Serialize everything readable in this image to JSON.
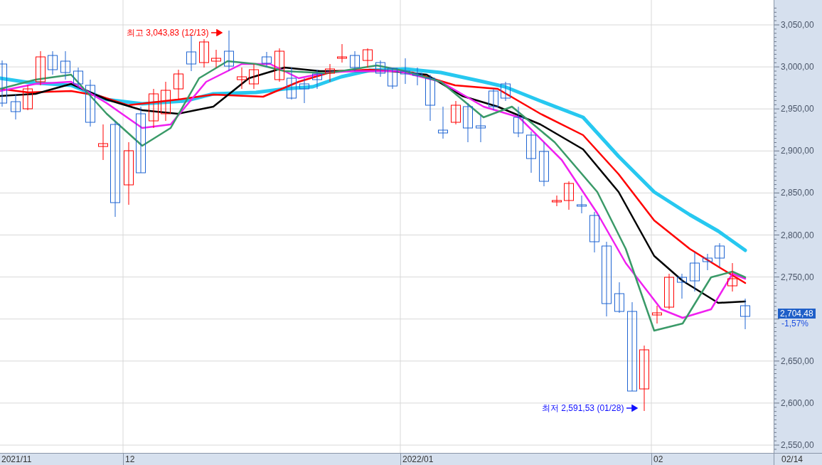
{
  "chart": {
    "high_marker": {
      "text": "최고 3,043,83 (12/13)"
    },
    "low_marker": {
      "text": "최저 2,591,53 (01/28)"
    }
  },
  "y_axis": {
    "labels": [
      {
        "kind": "tick",
        "label": "3,050,00"
      },
      {
        "kind": "tick",
        "label": "3,000,00"
      },
      {
        "kind": "tick",
        "label": "2,950,00"
      },
      {
        "kind": "tick",
        "label": "2,900,00"
      },
      {
        "kind": "tick",
        "label": "2,850,00"
      },
      {
        "kind": "tick",
        "label": "2,800,00"
      },
      {
        "kind": "tick",
        "label": "2,750,00"
      },
      {
        "kind": "last_price",
        "value": "2,704,48",
        "change": "-1,57%"
      },
      {
        "kind": "tick",
        "label": "2,650,00"
      },
      {
        "kind": "tick",
        "label": "2,600,00"
      },
      {
        "kind": "tick",
        "label": "2,550,00"
      }
    ]
  },
  "x_axis": {
    "labels": [
      "2021/11",
      "12",
      "2022/01",
      "02"
    ],
    "end_label": "02/14"
  }
}
